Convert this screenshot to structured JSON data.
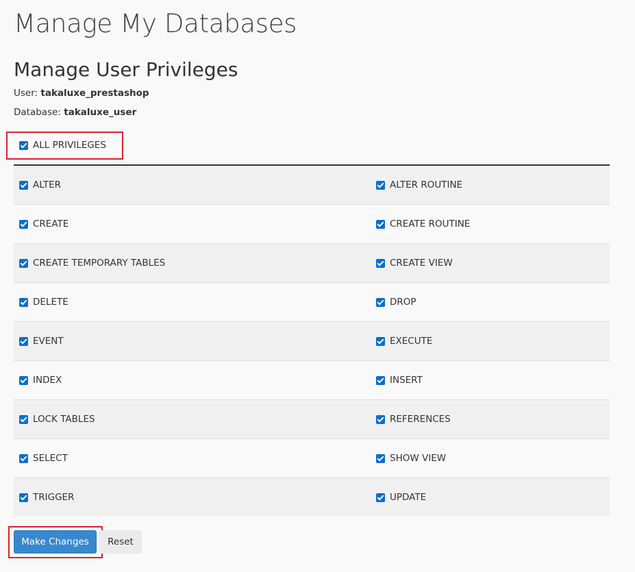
{
  "header": {
    "title": "Manage My Databases",
    "section_title": "Manage User Privileges"
  },
  "meta": {
    "user_label": "User:",
    "user_value": "takaluxe_prestashop",
    "database_label": "Database:",
    "database_value": "takaluxe_user"
  },
  "all_privileges": {
    "label": "ALL PRIVILEGES",
    "checked": true
  },
  "privileges": {
    "rows": [
      {
        "left": "ALTER",
        "right": "ALTER ROUTINE"
      },
      {
        "left": "CREATE",
        "right": "CREATE ROUTINE"
      },
      {
        "left": "CREATE TEMPORARY TABLES",
        "right": "CREATE VIEW"
      },
      {
        "left": "DELETE",
        "right": "DROP"
      },
      {
        "left": "EVENT",
        "right": "EXECUTE"
      },
      {
        "left": "INDEX",
        "right": "INSERT"
      },
      {
        "left": "LOCK TABLES",
        "right": "REFERENCES"
      },
      {
        "left": "SELECT",
        "right": "SHOW VIEW"
      },
      {
        "left": "TRIGGER",
        "right": "UPDATE"
      }
    ],
    "all_checked": true
  },
  "actions": {
    "submit_label": "Make Changes",
    "reset_label": "Reset"
  },
  "colors": {
    "checkbox": "#0a6ed1",
    "primary_button": "#3888d0",
    "highlight": "#d9232b"
  }
}
